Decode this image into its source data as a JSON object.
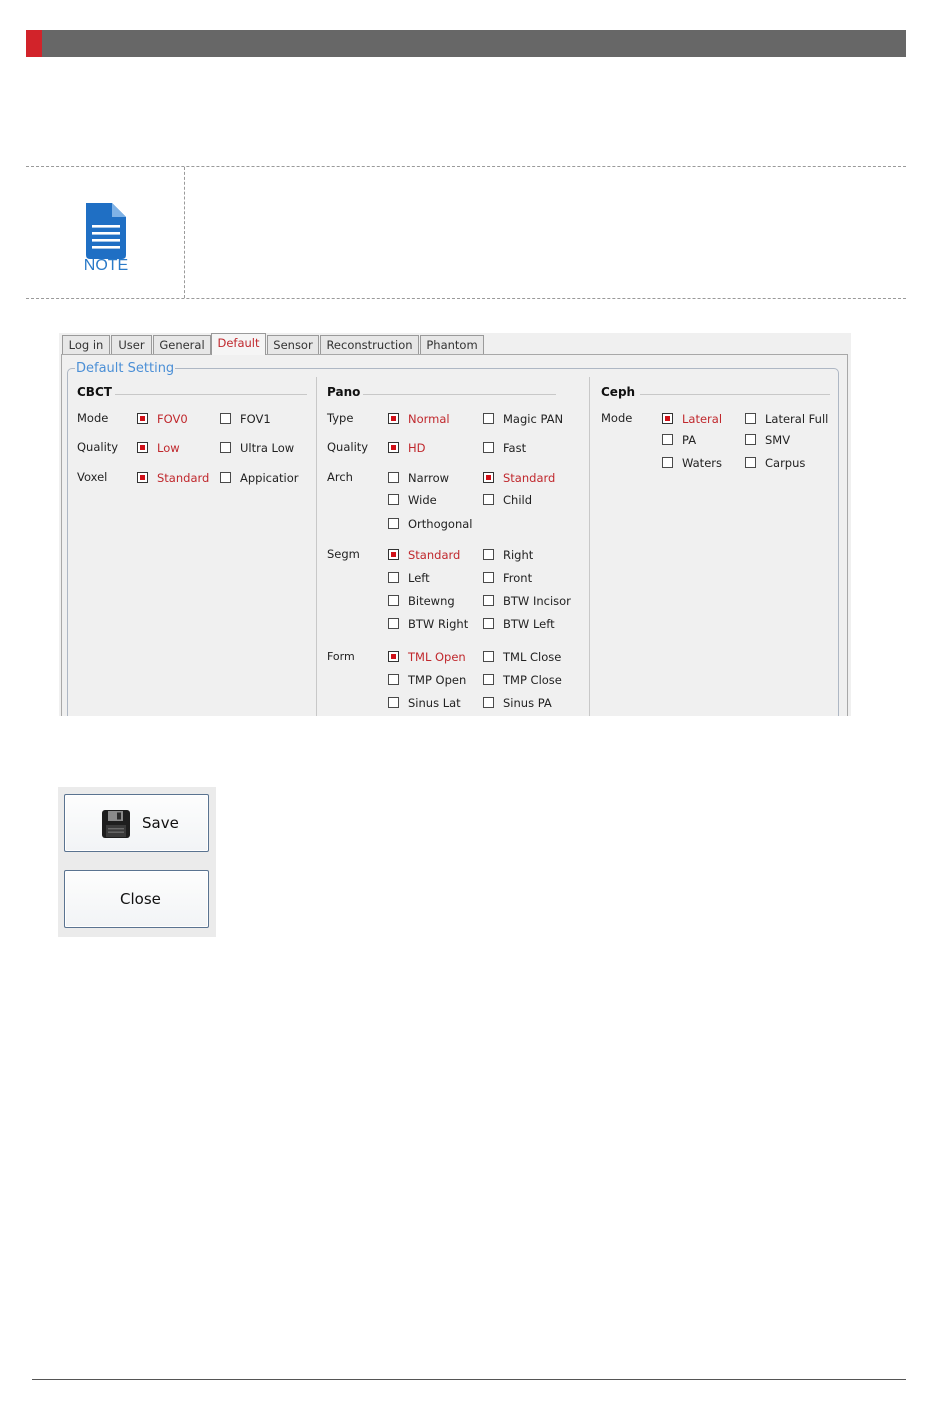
{
  "note": {
    "label": "NOTE",
    "icon": "document-icon"
  },
  "settings": {
    "tabs": [
      {
        "label": "Log in"
      },
      {
        "label": "User"
      },
      {
        "label": "General"
      },
      {
        "label": "Default"
      },
      {
        "label": "Sensor"
      },
      {
        "label": "Reconstruction"
      },
      {
        "label": "Phantom"
      }
    ],
    "active_tab": "Default",
    "group_title": "Default Setting",
    "cbct": {
      "title": "CBCT",
      "rows": [
        {
          "label": "Mode",
          "options": [
            {
              "text": "FOV0",
              "checked": true
            },
            {
              "text": "FOV1",
              "checked": false
            }
          ]
        },
        {
          "label": "Quality",
          "options": [
            {
              "text": "Low",
              "checked": true
            },
            {
              "text": "Ultra Low",
              "checked": false
            }
          ]
        },
        {
          "label": "Voxel",
          "options": [
            {
              "text": "Standard",
              "checked": true
            },
            {
              "text": "Appicatior",
              "checked": false
            }
          ]
        }
      ]
    },
    "pano": {
      "title": "Pano",
      "rows": [
        {
          "label": "Type",
          "options": [
            {
              "text": "Normal",
              "checked": true
            },
            {
              "text": "Magic PAN",
              "checked": false
            }
          ]
        },
        {
          "label": "Quality",
          "options": [
            {
              "text": "HD",
              "checked": true
            },
            {
              "text": "Fast",
              "checked": false
            }
          ]
        },
        {
          "label": "Arch",
          "options": [
            {
              "text": "Narrow",
              "checked": false
            },
            {
              "text": "Standard",
              "checked": true
            },
            {
              "text": "Wide",
              "checked": false
            },
            {
              "text": "Child",
              "checked": false
            },
            {
              "text": "Orthogonal",
              "checked": false
            }
          ]
        },
        {
          "label": "Segm",
          "options": [
            {
              "text": "Standard",
              "checked": true
            },
            {
              "text": "Right",
              "checked": false
            },
            {
              "text": "Left",
              "checked": false
            },
            {
              "text": "Front",
              "checked": false
            },
            {
              "text": "Bitewng",
              "checked": false
            },
            {
              "text": "BTW Incisor",
              "checked": false
            },
            {
              "text": "BTW Right",
              "checked": false
            },
            {
              "text": "BTW Left",
              "checked": false
            }
          ]
        },
        {
          "label": "Form",
          "options": [
            {
              "text": "TML Open",
              "checked": true
            },
            {
              "text": "TML Close",
              "checked": false
            },
            {
              "text": "TMP Open",
              "checked": false
            },
            {
              "text": "TMP Close",
              "checked": false
            },
            {
              "text": "Sinus Lat",
              "checked": false
            },
            {
              "text": "Sinus PA",
              "checked": false
            }
          ]
        }
      ]
    },
    "ceph": {
      "title": "Ceph",
      "rows": [
        {
          "label": "Mode",
          "options": [
            {
              "text": "Lateral",
              "checked": true
            },
            {
              "text": "Lateral Full",
              "checked": false
            },
            {
              "text": "PA",
              "checked": false
            },
            {
              "text": "SMV",
              "checked": false
            },
            {
              "text": "Waters",
              "checked": false
            },
            {
              "text": "Carpus",
              "checked": false
            }
          ]
        }
      ]
    }
  },
  "buttons": {
    "save": "Save",
    "close": "Close",
    "save_icon": "floppy-disk-icon"
  },
  "colors": {
    "accent_red": "#d2232a",
    "header_gray": "#676767",
    "note_blue": "#2a7ac8",
    "selected_text": "#c0282d"
  }
}
